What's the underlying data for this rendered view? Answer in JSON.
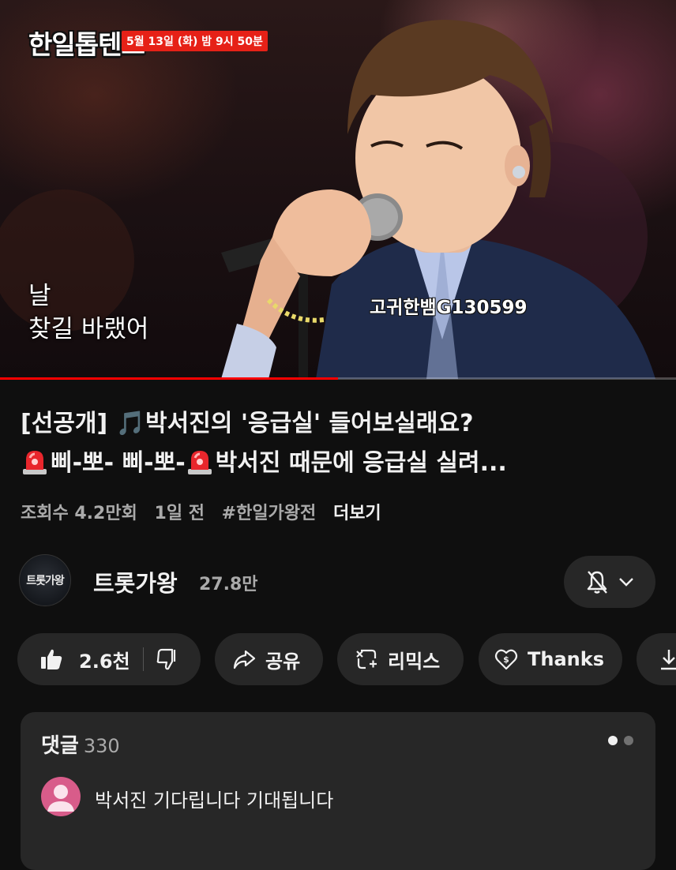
{
  "player": {
    "show_logo": "한일톱텐쇼",
    "airtime": "5월 13일 (화) 밤 9시 50분",
    "subtitle_line1": "날",
    "subtitle_line2": "찾길 바랬어",
    "watermark": "고귀한뱀G130599",
    "progress_fraction": 0.5
  },
  "video": {
    "title_line1_prefix": "[선공개] ",
    "title_line1_note": "🎵",
    "title_line1_rest": "박서진의 '응급실' 들어보실래요?",
    "title_line2_part1": "삐-뽀- 삐-뽀-",
    "title_line2_part2": "박서진 때문에 응급실 실려...",
    "views": "조회수 4.2만회",
    "age": "1일 전",
    "hashtag": "#한일가왕전",
    "more": "더보기"
  },
  "channel": {
    "avatar_text": "트롯가왕",
    "name": "트롯가왕",
    "subscribers": "27.8만"
  },
  "actions": {
    "like_count": "2.6천",
    "share": "공유",
    "remix": "리믹스",
    "thanks": "Thanks"
  },
  "comments": {
    "title": "댓글",
    "count": "330",
    "first_comment": "박서진 기다립니다 기대됩니다"
  },
  "colors": {
    "background": "#0f0f0f",
    "chip": "#272727",
    "accent_red": "#e62117",
    "avatar_pink": "#d85c8a"
  }
}
